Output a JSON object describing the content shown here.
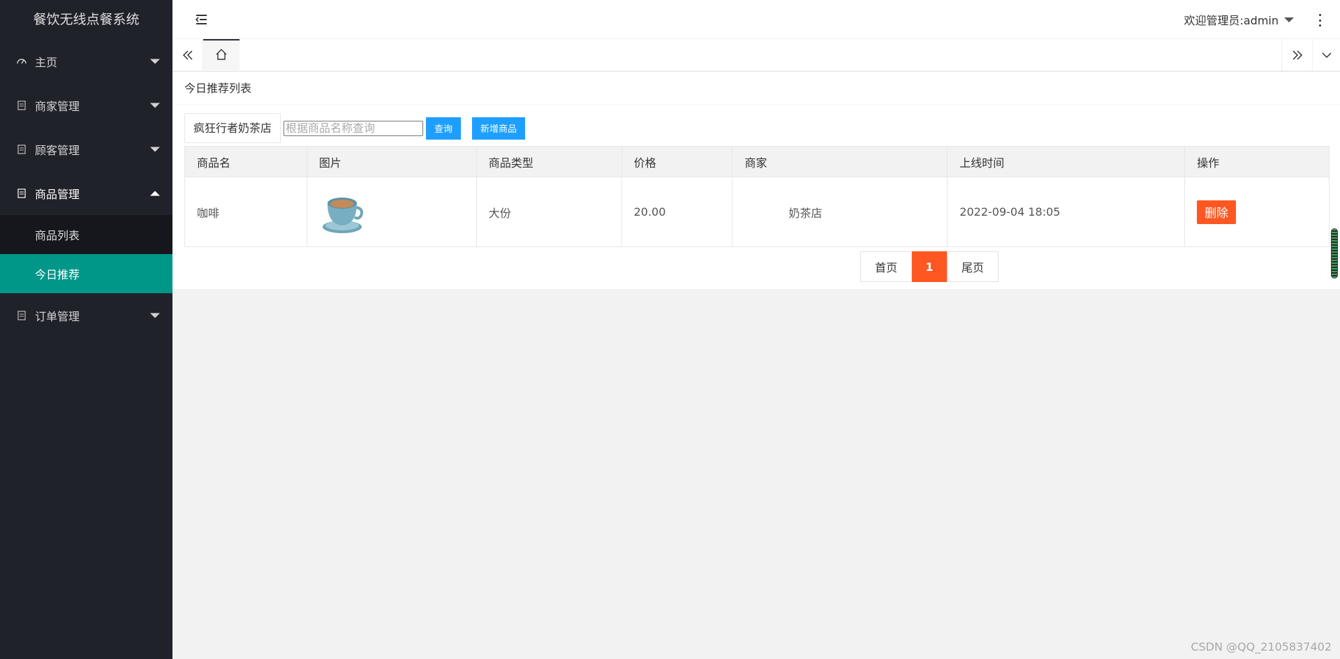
{
  "app": {
    "title": "餐饮无线点餐系统"
  },
  "sidebar": {
    "items": [
      {
        "label": "主页",
        "icon": "dashboard-icon"
      },
      {
        "label": "商家管理",
        "icon": "document-icon"
      },
      {
        "label": "顾客管理",
        "icon": "document-icon"
      },
      {
        "label": "商品管理",
        "icon": "document-icon",
        "expanded": true,
        "children": [
          {
            "label": "商品列表"
          },
          {
            "label": "今日推荐",
            "active": true
          }
        ]
      },
      {
        "label": "订单管理",
        "icon": "document-icon"
      }
    ]
  },
  "header": {
    "user_text": "欢迎管理员:admin"
  },
  "page": {
    "title": "今日推荐列表",
    "shop_name": "疯狂行者奶茶店",
    "search_placeholder": "根据商品名称查询",
    "search_value": "",
    "query_button": "查询",
    "add_button": "新增商品"
  },
  "table": {
    "columns": [
      "商品名",
      "图片",
      "商品类型",
      "价格",
      "商家",
      "上线时间",
      "操作"
    ],
    "rows": [
      {
        "name": "咖啡",
        "image": "coffee-cup-image",
        "type": "大份",
        "price": "20.00",
        "merchant": "奶茶店",
        "online_time": "2022-09-04 18:05",
        "action": "删除"
      }
    ]
  },
  "pagination": {
    "first": "首页",
    "current": "1",
    "last": "尾页"
  },
  "watermark": "CSDN @QQ_2105837402",
  "colors": {
    "sidebar_bg": "#20222a",
    "active_menu": "#009688",
    "primary_blue": "#1e9fff",
    "danger_orange": "#ff5722"
  }
}
